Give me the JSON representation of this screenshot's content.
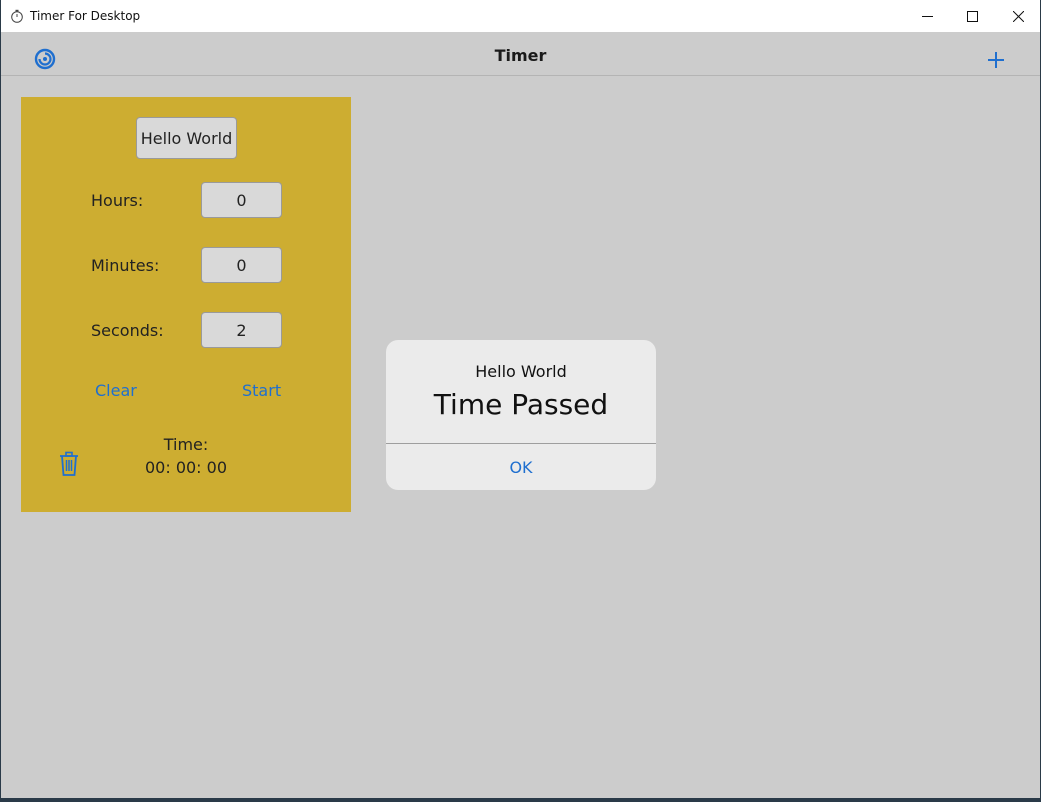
{
  "window": {
    "title": "Timer For Desktop"
  },
  "header": {
    "title": "Timer",
    "accent_color": "#1f6fcf"
  },
  "timer_card": {
    "background_color": "#cdad31",
    "name_button_label": "Hello World",
    "hours_label": "Hours:",
    "hours_value": "0",
    "minutes_label": "Minutes:",
    "minutes_value": "0",
    "seconds_label": "Seconds:",
    "seconds_value": "2",
    "clear_label": "Clear",
    "start_label": "Start",
    "time_label": "Time:",
    "time_value": "00: 00: 00"
  },
  "dialog": {
    "title": "Hello World",
    "message": "Time Passed",
    "ok_label": "OK"
  },
  "icons": {
    "app": "stopwatch-icon",
    "header_left": "timer-icon",
    "header_right": "plus-icon",
    "card": "trash-icon"
  }
}
